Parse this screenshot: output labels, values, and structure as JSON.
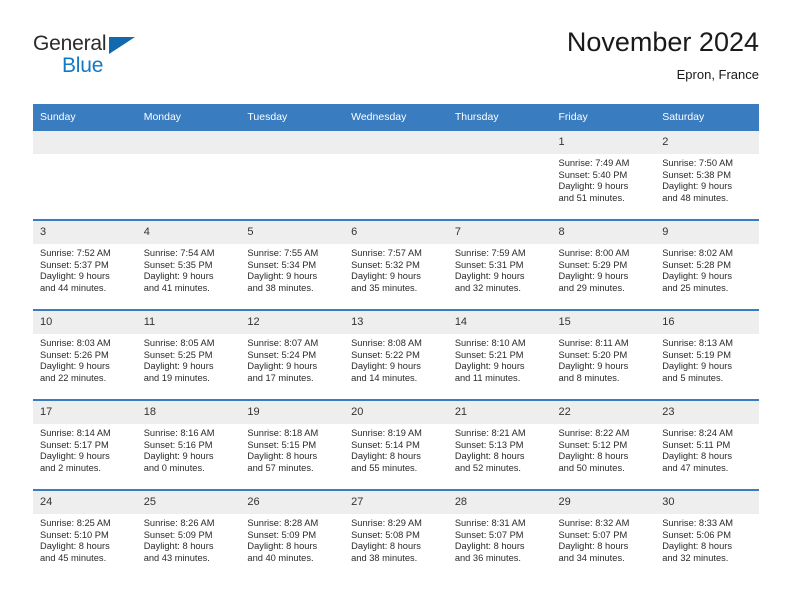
{
  "brand": {
    "name_top": "General",
    "name_bottom": "Blue",
    "triangle_icon": "triangle-icon",
    "color_dark": "#2b2b2b",
    "color_blue": "#1279c5"
  },
  "header": {
    "title": "November 2024",
    "subtitle": "Epron, France"
  },
  "theme": {
    "header_bg": "#3a7cc0",
    "header_text": "#ffffff",
    "daynum_bg": "#eeeeee",
    "cell_bg": "#ffffff",
    "rule_color": "#3a7cc0"
  },
  "weekdays": [
    "Sunday",
    "Monday",
    "Tuesday",
    "Wednesday",
    "Thursday",
    "Friday",
    "Saturday"
  ],
  "labels": {
    "sunrise_prefix": "Sunrise:",
    "sunset_prefix": "Sunset:",
    "daylight_prefix": "Daylight:"
  },
  "weeks": [
    [
      {
        "day": "",
        "empty": true
      },
      {
        "day": "",
        "empty": true
      },
      {
        "day": "",
        "empty": true
      },
      {
        "day": "",
        "empty": true
      },
      {
        "day": "",
        "empty": true
      },
      {
        "day": "1",
        "sunrise": "Sunrise: 7:49 AM",
        "sunset": "Sunset: 5:40 PM",
        "daylight1": "Daylight: 9 hours",
        "daylight2": "and 51 minutes."
      },
      {
        "day": "2",
        "sunrise": "Sunrise: 7:50 AM",
        "sunset": "Sunset: 5:38 PM",
        "daylight1": "Daylight: 9 hours",
        "daylight2": "and 48 minutes."
      }
    ],
    [
      {
        "day": "3",
        "sunrise": "Sunrise: 7:52 AM",
        "sunset": "Sunset: 5:37 PM",
        "daylight1": "Daylight: 9 hours",
        "daylight2": "and 44 minutes."
      },
      {
        "day": "4",
        "sunrise": "Sunrise: 7:54 AM",
        "sunset": "Sunset: 5:35 PM",
        "daylight1": "Daylight: 9 hours",
        "daylight2": "and 41 minutes."
      },
      {
        "day": "5",
        "sunrise": "Sunrise: 7:55 AM",
        "sunset": "Sunset: 5:34 PM",
        "daylight1": "Daylight: 9 hours",
        "daylight2": "and 38 minutes."
      },
      {
        "day": "6",
        "sunrise": "Sunrise: 7:57 AM",
        "sunset": "Sunset: 5:32 PM",
        "daylight1": "Daylight: 9 hours",
        "daylight2": "and 35 minutes."
      },
      {
        "day": "7",
        "sunrise": "Sunrise: 7:59 AM",
        "sunset": "Sunset: 5:31 PM",
        "daylight1": "Daylight: 9 hours",
        "daylight2": "and 32 minutes."
      },
      {
        "day": "8",
        "sunrise": "Sunrise: 8:00 AM",
        "sunset": "Sunset: 5:29 PM",
        "daylight1": "Daylight: 9 hours",
        "daylight2": "and 29 minutes."
      },
      {
        "day": "9",
        "sunrise": "Sunrise: 8:02 AM",
        "sunset": "Sunset: 5:28 PM",
        "daylight1": "Daylight: 9 hours",
        "daylight2": "and 25 minutes."
      }
    ],
    [
      {
        "day": "10",
        "sunrise": "Sunrise: 8:03 AM",
        "sunset": "Sunset: 5:26 PM",
        "daylight1": "Daylight: 9 hours",
        "daylight2": "and 22 minutes."
      },
      {
        "day": "11",
        "sunrise": "Sunrise: 8:05 AM",
        "sunset": "Sunset: 5:25 PM",
        "daylight1": "Daylight: 9 hours",
        "daylight2": "and 19 minutes."
      },
      {
        "day": "12",
        "sunrise": "Sunrise: 8:07 AM",
        "sunset": "Sunset: 5:24 PM",
        "daylight1": "Daylight: 9 hours",
        "daylight2": "and 17 minutes."
      },
      {
        "day": "13",
        "sunrise": "Sunrise: 8:08 AM",
        "sunset": "Sunset: 5:22 PM",
        "daylight1": "Daylight: 9 hours",
        "daylight2": "and 14 minutes."
      },
      {
        "day": "14",
        "sunrise": "Sunrise: 8:10 AM",
        "sunset": "Sunset: 5:21 PM",
        "daylight1": "Daylight: 9 hours",
        "daylight2": "and 11 minutes."
      },
      {
        "day": "15",
        "sunrise": "Sunrise: 8:11 AM",
        "sunset": "Sunset: 5:20 PM",
        "daylight1": "Daylight: 9 hours",
        "daylight2": "and 8 minutes."
      },
      {
        "day": "16",
        "sunrise": "Sunrise: 8:13 AM",
        "sunset": "Sunset: 5:19 PM",
        "daylight1": "Daylight: 9 hours",
        "daylight2": "and 5 minutes."
      }
    ],
    [
      {
        "day": "17",
        "sunrise": "Sunrise: 8:14 AM",
        "sunset": "Sunset: 5:17 PM",
        "daylight1": "Daylight: 9 hours",
        "daylight2": "and 2 minutes."
      },
      {
        "day": "18",
        "sunrise": "Sunrise: 8:16 AM",
        "sunset": "Sunset: 5:16 PM",
        "daylight1": "Daylight: 9 hours",
        "daylight2": "and 0 minutes."
      },
      {
        "day": "19",
        "sunrise": "Sunrise: 8:18 AM",
        "sunset": "Sunset: 5:15 PM",
        "daylight1": "Daylight: 8 hours",
        "daylight2": "and 57 minutes."
      },
      {
        "day": "20",
        "sunrise": "Sunrise: 8:19 AM",
        "sunset": "Sunset: 5:14 PM",
        "daylight1": "Daylight: 8 hours",
        "daylight2": "and 55 minutes."
      },
      {
        "day": "21",
        "sunrise": "Sunrise: 8:21 AM",
        "sunset": "Sunset: 5:13 PM",
        "daylight1": "Daylight: 8 hours",
        "daylight2": "and 52 minutes."
      },
      {
        "day": "22",
        "sunrise": "Sunrise: 8:22 AM",
        "sunset": "Sunset: 5:12 PM",
        "daylight1": "Daylight: 8 hours",
        "daylight2": "and 50 minutes."
      },
      {
        "day": "23",
        "sunrise": "Sunrise: 8:24 AM",
        "sunset": "Sunset: 5:11 PM",
        "daylight1": "Daylight: 8 hours",
        "daylight2": "and 47 minutes."
      }
    ],
    [
      {
        "day": "24",
        "sunrise": "Sunrise: 8:25 AM",
        "sunset": "Sunset: 5:10 PM",
        "daylight1": "Daylight: 8 hours",
        "daylight2": "and 45 minutes."
      },
      {
        "day": "25",
        "sunrise": "Sunrise: 8:26 AM",
        "sunset": "Sunset: 5:09 PM",
        "daylight1": "Daylight: 8 hours",
        "daylight2": "and 43 minutes."
      },
      {
        "day": "26",
        "sunrise": "Sunrise: 8:28 AM",
        "sunset": "Sunset: 5:09 PM",
        "daylight1": "Daylight: 8 hours",
        "daylight2": "and 40 minutes."
      },
      {
        "day": "27",
        "sunrise": "Sunrise: 8:29 AM",
        "sunset": "Sunset: 5:08 PM",
        "daylight1": "Daylight: 8 hours",
        "daylight2": "and 38 minutes."
      },
      {
        "day": "28",
        "sunrise": "Sunrise: 8:31 AM",
        "sunset": "Sunset: 5:07 PM",
        "daylight1": "Daylight: 8 hours",
        "daylight2": "and 36 minutes."
      },
      {
        "day": "29",
        "sunrise": "Sunrise: 8:32 AM",
        "sunset": "Sunset: 5:07 PM",
        "daylight1": "Daylight: 8 hours",
        "daylight2": "and 34 minutes."
      },
      {
        "day": "30",
        "sunrise": "Sunrise: 8:33 AM",
        "sunset": "Sunset: 5:06 PM",
        "daylight1": "Daylight: 8 hours",
        "daylight2": "and 32 minutes."
      }
    ]
  ]
}
